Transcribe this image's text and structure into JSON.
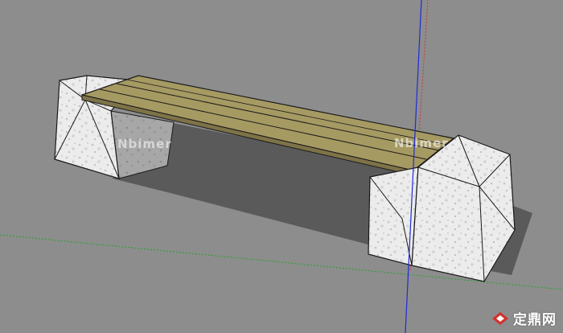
{
  "viewport": {
    "background": "#8d8d8d"
  },
  "axes": {
    "blue": "#1f2bd6",
    "red": "#c2393a",
    "green": "#2aa22a"
  },
  "materials": {
    "wood": "#a79a63",
    "stone": "#e9e9e9",
    "stone_shadow": "#7a7a7a",
    "ground_shadow": "#555555",
    "edge": "#1a1a1a"
  },
  "watermarks": {
    "left": "Nbimer",
    "right": "Nbimer"
  },
  "logo": {
    "text": "定鼎网",
    "icon": "diamond-logo-icon"
  }
}
